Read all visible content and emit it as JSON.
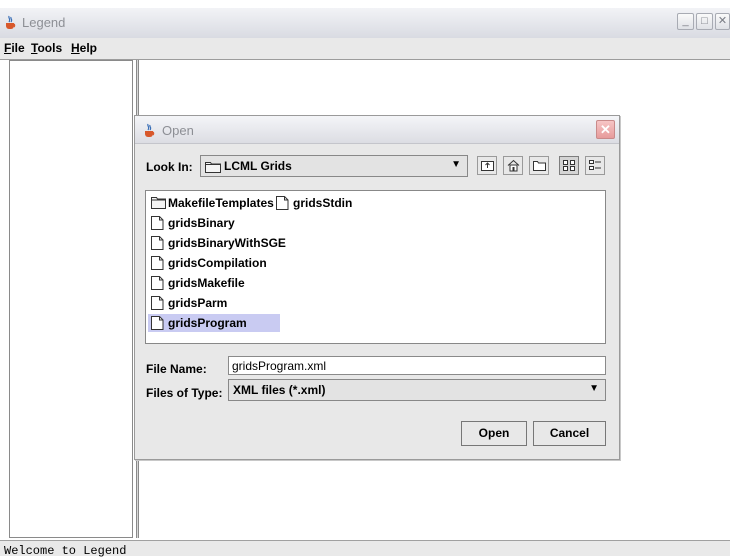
{
  "window": {
    "title": "Legend"
  },
  "menubar": {
    "file": "File",
    "tools": "Tools",
    "help": "Help"
  },
  "statusbar": {
    "text": "Welcome to Legend"
  },
  "dialog": {
    "title": "Open",
    "look_in_label": "Look In:",
    "look_in_value": "LCML Grids",
    "toolbar_icons": [
      "up-one-level-icon",
      "home-icon",
      "new-folder-icon",
      "list-view-icon",
      "details-view-icon"
    ],
    "files": [
      {
        "name": "MakefileTemplates",
        "type": "folder"
      },
      {
        "name": "gridsStdin",
        "type": "file"
      },
      {
        "name": "gridsBinary",
        "type": "file"
      },
      {
        "name": "gridsBinaryWithSGE",
        "type": "file"
      },
      {
        "name": "gridsCompilation",
        "type": "file"
      },
      {
        "name": "gridsMakefile",
        "type": "file"
      },
      {
        "name": "gridsParm",
        "type": "file"
      },
      {
        "name": "gridsProgram",
        "type": "file",
        "selected": true
      }
    ],
    "file_name_label": "File Name:",
    "file_name_value": "gridsProgram.xml",
    "files_of_type_label": "Files of Type:",
    "files_of_type_value": "XML files (*.xml)",
    "open_button": "Open",
    "cancel_button": "Cancel"
  },
  "colors": {
    "selection": "#c9cbf2",
    "close_button": "#e79b9b"
  }
}
